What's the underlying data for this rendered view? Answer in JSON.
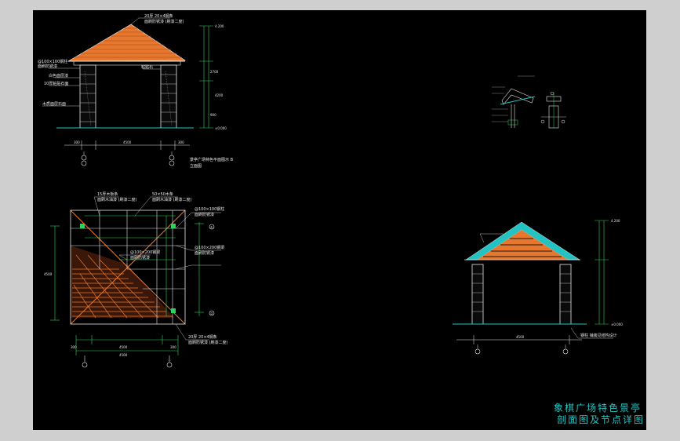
{
  "title": {
    "line1": "象棋广场特色景亭",
    "line2": "剖面图及节点详图"
  },
  "colors": {
    "background": "#000000",
    "frame": "#cfcfcf",
    "roof_orange": "#e8772e",
    "dimension_green": "#2fd35a",
    "accent_cyan": "#23c3c3",
    "lines_white": "#e6e6e6"
  },
  "elevation_labels": {
    "ridge_top": "20厚 20×4钢条",
    "ridge_finish": "面刷防锈漆 (刷漆二度)",
    "rafter_a": "@100×100钢柱",
    "rafter_a_finish": "面刷防锈漆",
    "column_paint": "白色面层漆",
    "column_brick": "10厚粘贴石面",
    "column_detail": "粘贴石",
    "base": "木质面层石面",
    "caption_line1": "景亭广场特色平面图示 B",
    "caption_line2": "立面图"
  },
  "plan_labels": {
    "top_left": "15厚木板条",
    "top_left_finish": "面刷木油漆 (刷漆二度)",
    "top_mid": "50×50木条",
    "top_mid_finish": "面刷木油漆 (刷漆二度)",
    "right_a": "@100×100钢柱",
    "right_a_finish": "面刷防锈漆",
    "right_b": "@100×200钢梁",
    "right_b_finish": "面刷防锈漆",
    "right_c": "@100×200钢梁",
    "right_c_finish": "面刷防锈漆",
    "bottom": "20厚 20×4钢条",
    "bottom_finish": "面刷防锈漆 (刷漆二度)"
  },
  "section_labels": {
    "column_base": "钢柱 铺装见结构设计"
  },
  "dimensions": {
    "elev_span": "4500",
    "elev_side_left": "300",
    "elev_side_right": "300",
    "elev_h1": "4200",
    "elev_h2": "2700",
    "elev_h3": "900",
    "elev_level_top": "4.200",
    "elev_level_bottom": "±0.000",
    "plan_span": "4500",
    "plan_side_left": "300",
    "plan_side_right": "300",
    "plan_height": "4500",
    "sec_span": "4500",
    "sec_level_top": "4.200",
    "sec_level_bottom": "±0.000"
  },
  "axis_markers": {
    "a": "①",
    "b": "②"
  }
}
